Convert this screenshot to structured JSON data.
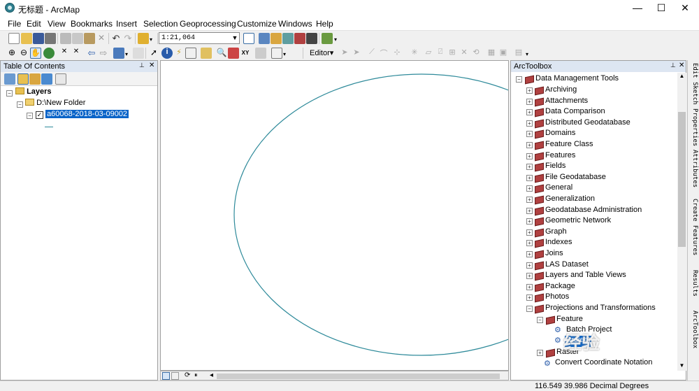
{
  "window": {
    "title": "无标题 - ArcMap",
    "minimize": "—",
    "maximize": "☐",
    "close": "✕"
  },
  "menu": [
    "File",
    "Edit",
    "View",
    "Bookmarks",
    "Insert",
    "Selection",
    "Geoprocessing",
    "Customize",
    "Windows",
    "Help"
  ],
  "standard_toolbar": {
    "scale": "1:21,064"
  },
  "editor_toolbar": {
    "editor_label": "Editor▾"
  },
  "toc": {
    "title": "Table Of Contents",
    "pin": "📌",
    "close": "✕",
    "layers_label": "Layers",
    "folder": "D:\\New Folder",
    "layer": "a60068-2018-03-09002"
  },
  "toolbox": {
    "title": "ArcToolbox",
    "root": "Data Management Tools",
    "items": [
      "Archiving",
      "Attachments",
      "Data Comparison",
      "Distributed Geodatabase",
      "Domains",
      "Feature Class",
      "Features",
      "Fields",
      "File Geodatabase",
      "General",
      "Generalization",
      "Geodatabase Administration",
      "Geometric Network",
      "Graph",
      "Indexes",
      "Joins",
      "LAS Dataset",
      "Layers and Table Views",
      "Package",
      "Photos",
      "Projections and Transformations"
    ],
    "feature_label": "Feature",
    "feature_tools": [
      "Batch Project",
      "Project"
    ],
    "raster_label": "Raster",
    "convert_tool": "Convert Coordinate Notation"
  },
  "dock_tabs": [
    "Edit Sketch Properties",
    "Attributes",
    "Create Features",
    "Results",
    "ArcToolbox"
  ],
  "status": {
    "coordinates": "116.549  39.986 Decimal Degrees"
  },
  "colors": {
    "map_ellipse": "#2e8a9a",
    "selection": "#0a64c8",
    "panel_header": "#dde6f2"
  },
  "watermark": "经验"
}
